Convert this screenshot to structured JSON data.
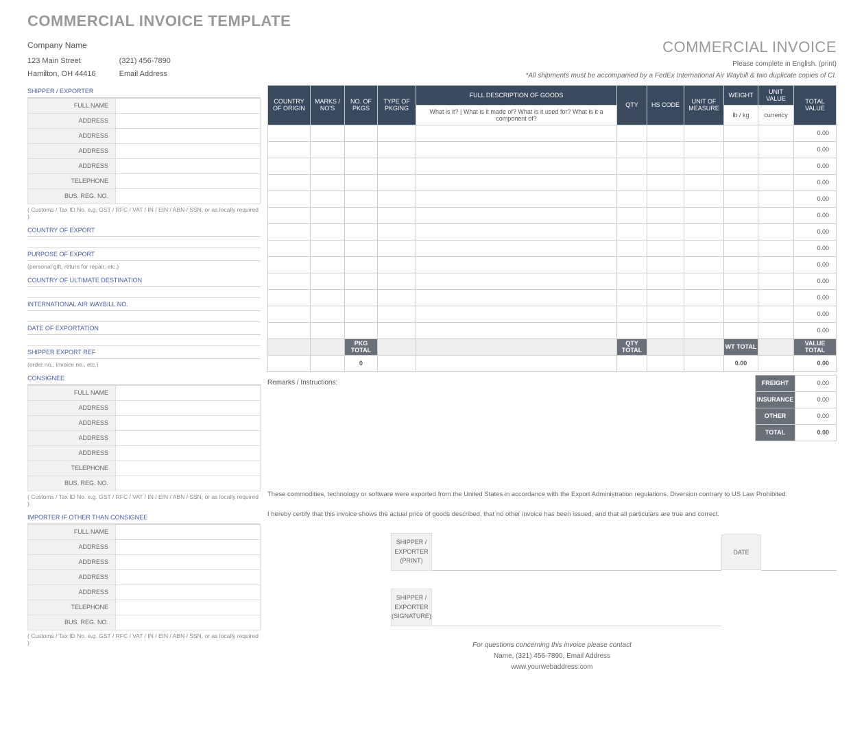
{
  "title": "COMMERCIAL INVOICE TEMPLATE",
  "header_right": "COMMERCIAL INVOICE",
  "company": {
    "name": "Company Name",
    "street": "123 Main Street",
    "city": "Hamilton, OH  44416",
    "phone": "(321) 456-7890",
    "email": "Email Address"
  },
  "notes": {
    "complete_english": "Please complete in English. (print)",
    "shipment_note": "*All shipments must be accompanied by a FedEx International Air Waybill & two duplicate copies of CI."
  },
  "left": {
    "shipper_header": "SHIPPER / EXPORTER",
    "labels": {
      "full_name": "FULL NAME",
      "address": "ADDRESS",
      "telephone": "TELEPHONE",
      "bus_reg": "BUS. REG. NO."
    },
    "customs_hint": "( Customs / Tax ID No. e.g. GST / RFC / VAT / IN / EIN / ABN / SSN, or as locally required )",
    "country_export": "COUNTRY OF EXPORT",
    "purpose_export": "PURPOSE OF EXPORT",
    "purpose_hint": "(personal gift, return for repair, etc.)",
    "ultimate_dest": "COUNTRY OF ULTIMATE DESTINATION",
    "air_waybill": "INTERNATIONAL AIR WAYBILL NO.",
    "date_export": "DATE OF EXPORTATION",
    "shipper_ref": "SHIPPER EXPORT REF",
    "shipper_ref_hint": "(order no., invoice no., etc.)",
    "consignee": "CONSIGNEE",
    "importer": "IMPORTER IF OTHER THAN CONSIGNEE"
  },
  "goods": {
    "headers": {
      "country": "COUNTRY OF ORIGIN",
      "marks": "MARKS / NO'S",
      "no_pkgs": "NO. OF PKGS",
      "type_pkg": "TYPE OF PKGING",
      "full_desc": "FULL DESCRIPTION OF GOODS",
      "desc_sub": "What is it?  |  What is it made of?  What is it used for?  What is it a component of?",
      "qty": "QTY",
      "hs": "HS CODE",
      "uom": "UNIT OF MEASURE",
      "weight": "WEIGHT",
      "weight_sub": "lb / kg",
      "unit_value": "UNIT VALUE",
      "unit_value_sub": "currency",
      "total_value": "TOTAL VALUE"
    },
    "row_total": "0.00",
    "totals": {
      "pkg_label": "PKG TOTAL",
      "pkg_value": "0",
      "qty_label": "QTY TOTAL",
      "wt_label": "WT TOTAL",
      "wt_value": "0.00",
      "value_label": "VALUE TOTAL",
      "value_total": "0.00"
    },
    "remarks": "Remarks / Instructions:",
    "summary": {
      "freight": "FREIGHT",
      "insurance": "INSURANCE",
      "other": "OTHER",
      "total": "TOTAL",
      "val": "0.00",
      "total_val": "0.00"
    }
  },
  "legal": {
    "export_note": "These commodities, technology or software were exported from the United States in accordance with the Export Administration regulations.  Diversion contrary to US Law Prohibited.",
    "certify": "I hereby certify that this invoice shows the actual price of goods described, that no other invoice has been issued, and that all particulars are true and correct."
  },
  "sig": {
    "print": "SHIPPER / EXPORTER (PRINT)",
    "date": "DATE",
    "signature": "SHIPPER / EXPORTER (SIGNATURE)"
  },
  "footer": {
    "q": "For questions concerning this invoice please contact",
    "contact": "Name, (321) 456-7890, Email Address",
    "web": "www.yourwebaddress.com"
  }
}
